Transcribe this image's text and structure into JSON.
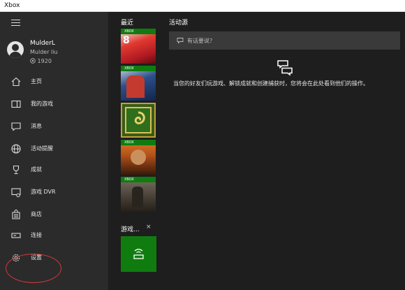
{
  "window": {
    "title": "Xbox"
  },
  "profile": {
    "name": "MulderL",
    "gamertag": "Mulder liu",
    "gamerscore": "1920"
  },
  "nav": [
    {
      "label": "主页",
      "icon": "home-icon"
    },
    {
      "label": "我的游戏",
      "icon": "games-library-icon"
    },
    {
      "label": "消息",
      "icon": "message-icon"
    },
    {
      "label": "活动提醒",
      "icon": "globe-icon"
    },
    {
      "label": "成就",
      "icon": "trophy-icon"
    },
    {
      "label": "游戏 DVR",
      "icon": "dvr-icon"
    },
    {
      "label": "商店",
      "icon": "store-icon"
    },
    {
      "label": "连接",
      "icon": "connect-icon"
    },
    {
      "label": "设置",
      "icon": "gear-icon"
    }
  ],
  "recent": {
    "title": "最近",
    "tiles": [
      {
        "band_label": "XBOX",
        "color": "#c8202a"
      },
      {
        "band_label": "XBOX",
        "color": "#1f3f7a"
      },
      {
        "band_label": "",
        "color": "#2f6e1c"
      },
      {
        "band_label": "XBOX",
        "color": "#b0501a"
      },
      {
        "band_label": "XBOX",
        "color": "#4a4238"
      }
    ]
  },
  "party": {
    "title": "游戏...",
    "close": "×"
  },
  "feed": {
    "title": "活动源",
    "input_placeholder": "有话要说？",
    "empty_message": "当您的好友们玩游戏、解锁成就和创建捕获时，您将会在此处看到他们的操作。"
  },
  "colors": {
    "sidebar": "#2b2b2b",
    "main": "#1e1e1e",
    "xbox_green": "#107c10",
    "annotation": "#d23a3a"
  }
}
